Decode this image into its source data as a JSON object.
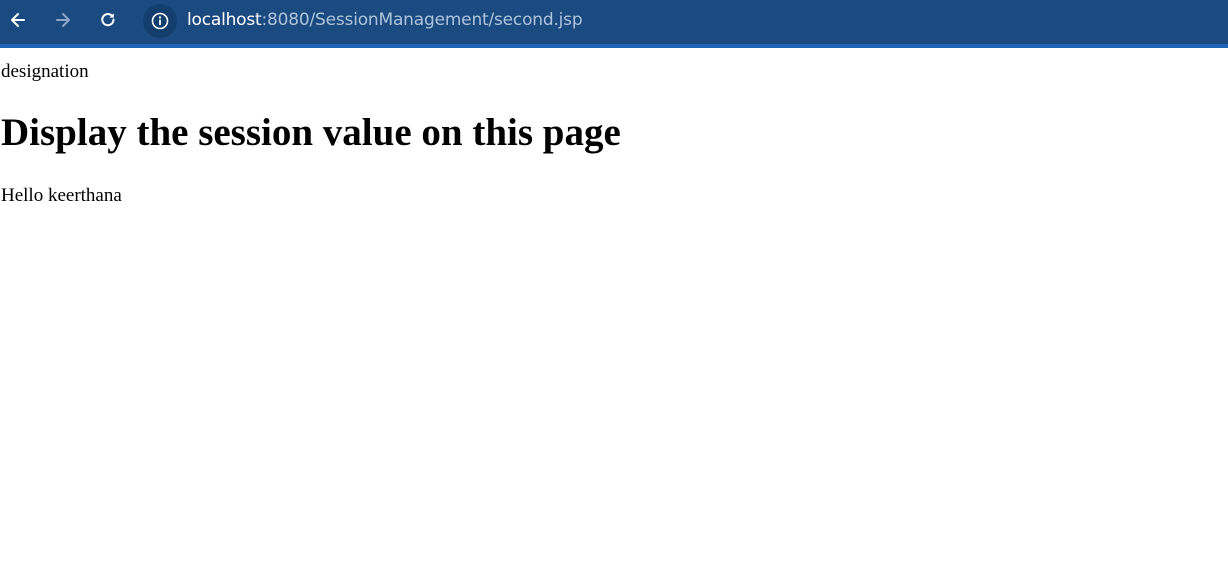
{
  "browser": {
    "url_host": "localhost",
    "url_rest": ":8080/SessionManagement/second.jsp",
    "toolbar_icons": [
      "back-arrow-icon",
      "forward-arrow-icon",
      "reload-icon",
      "info-icon"
    ],
    "colors": {
      "toolbar": "#1a4a80",
      "accent": "#1e63b8",
      "url_host": "#ffffff",
      "url_rest": "#aec4dc"
    }
  },
  "page": {
    "designation": "designation",
    "heading": "Display the session value on this page",
    "greeting": "Hello keerthana"
  }
}
